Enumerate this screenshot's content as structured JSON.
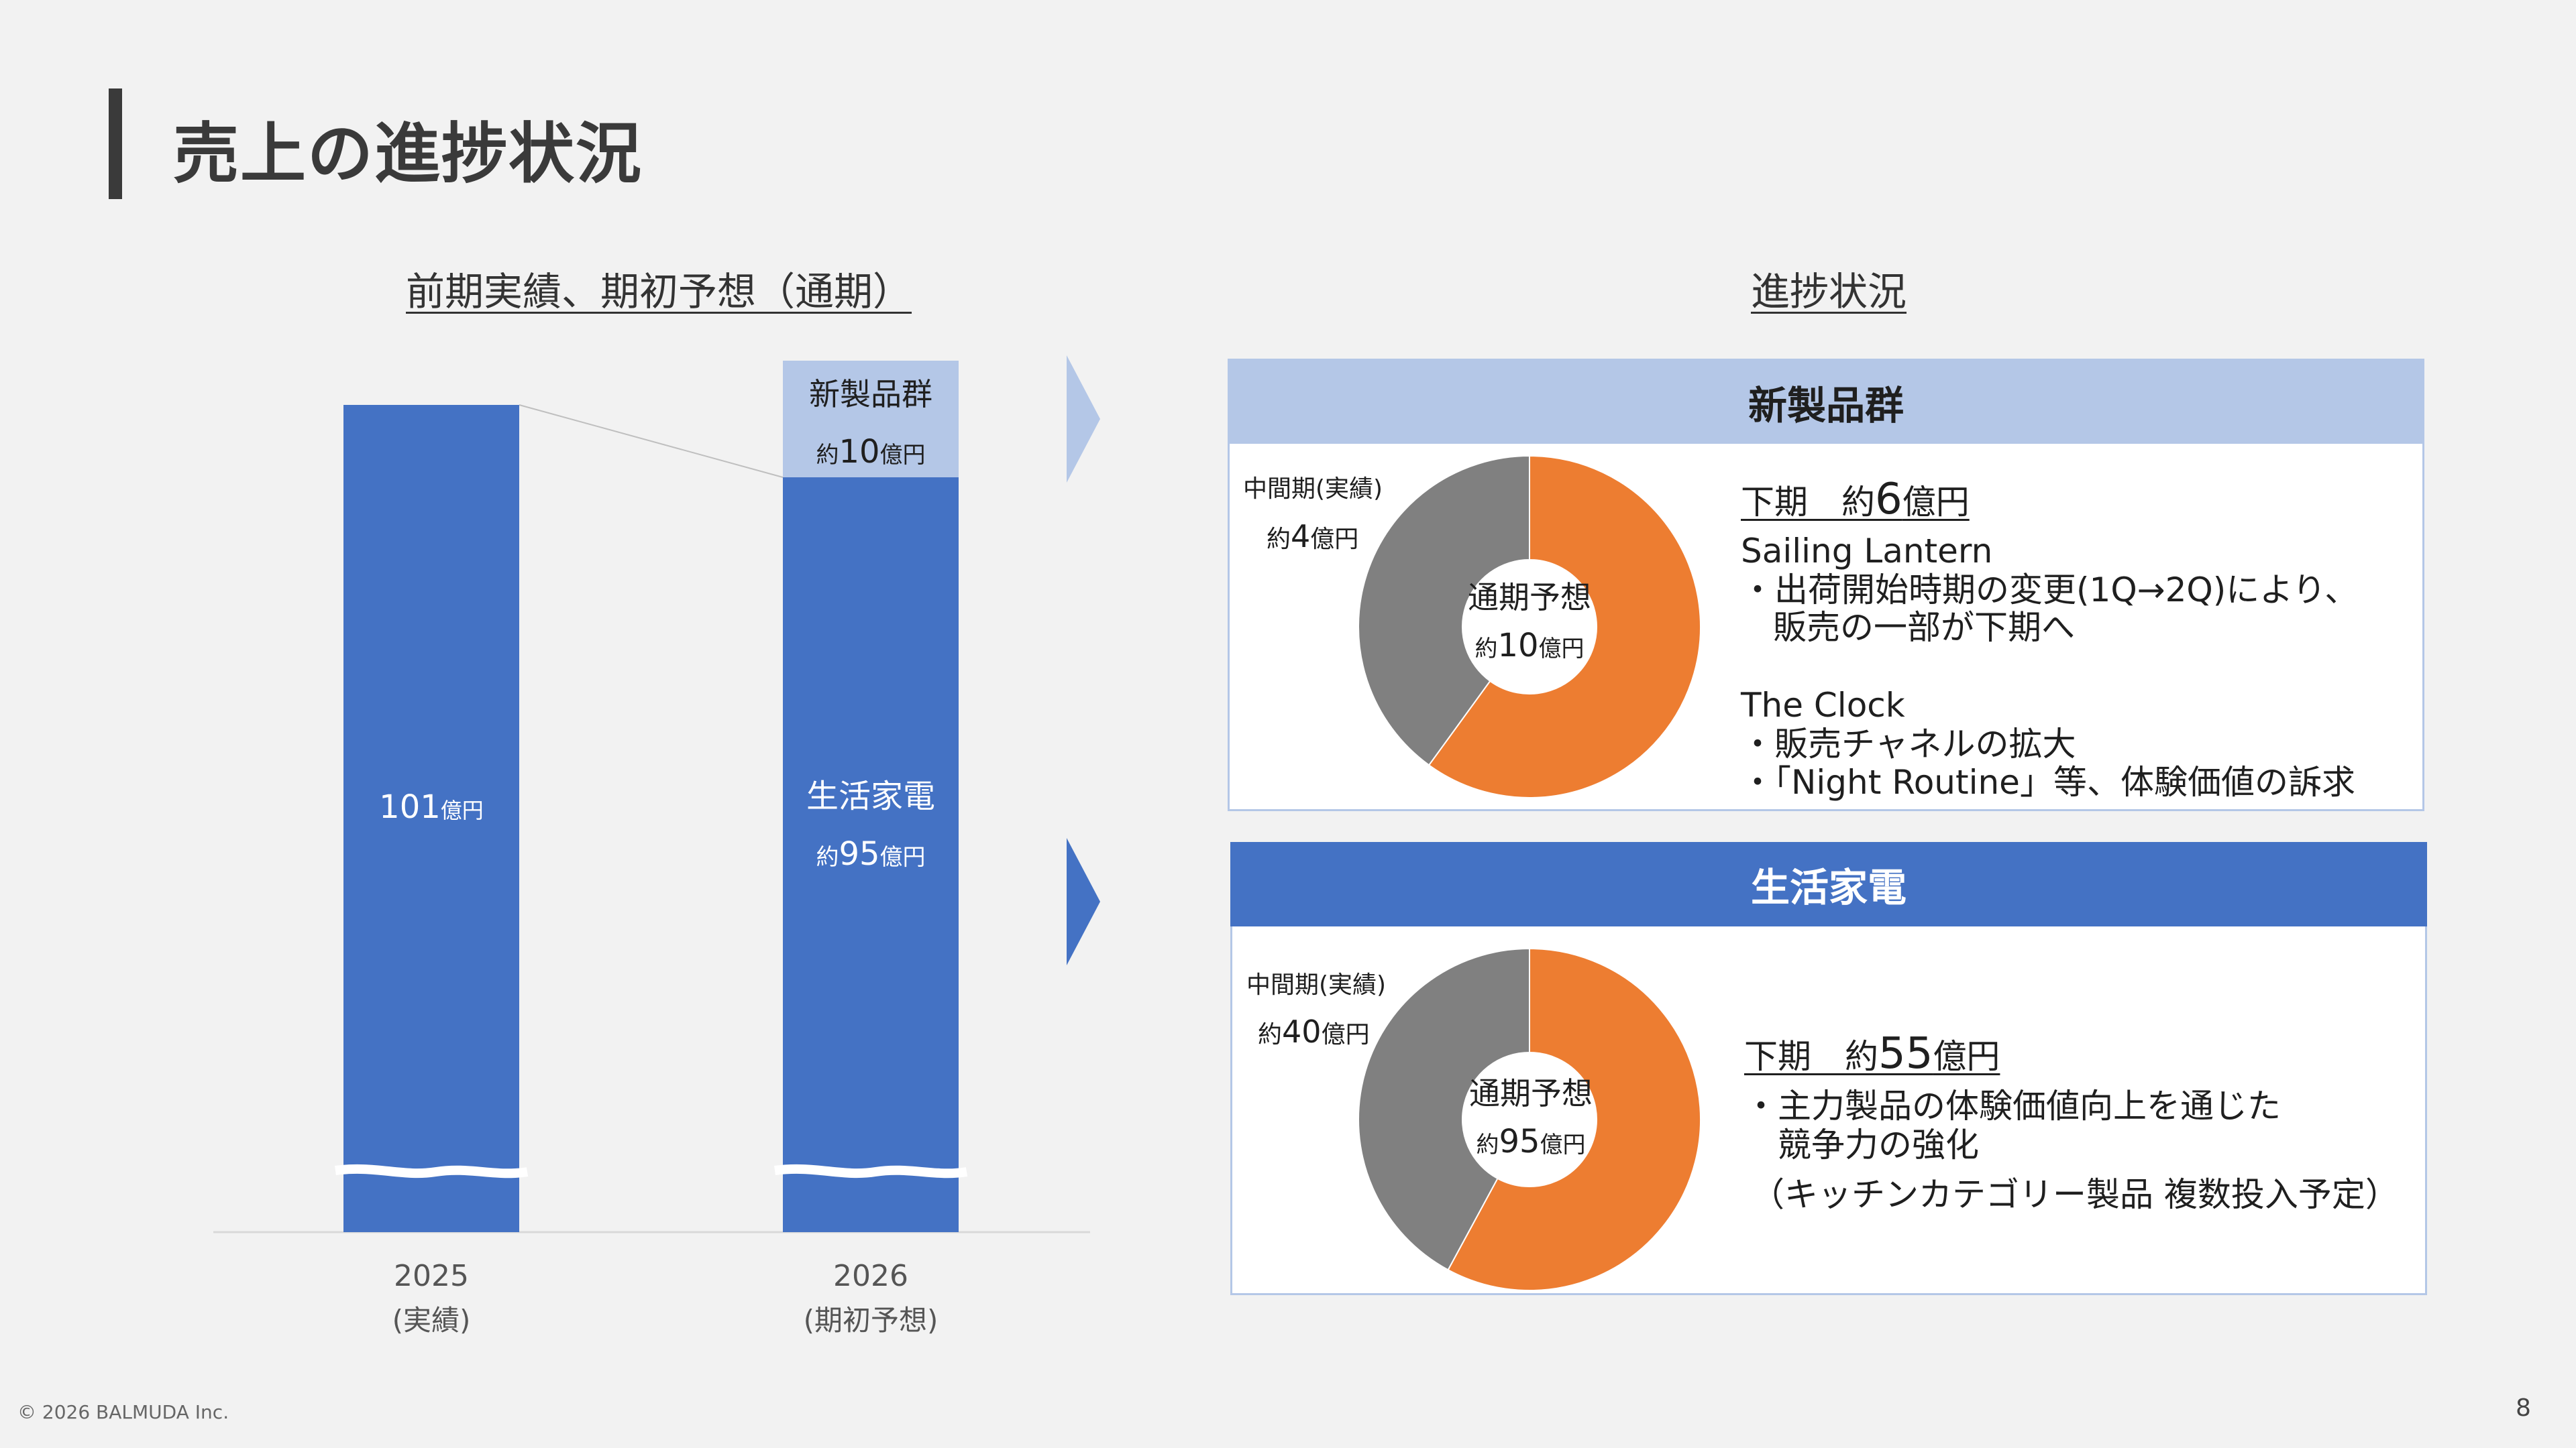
{
  "page": {
    "title": "売上の進捗状況",
    "footer": "© 2026 BALMUDA Inc.",
    "page_number": "8"
  },
  "left": {
    "heading": "前期実績、期初予想（通期）",
    "bar2025_label": "101億円",
    "bar2025_value": "101",
    "bar2025_unit": "億円",
    "top_segment_name": "新製品群",
    "top_segment_prefix": "約",
    "top_segment_value": "10",
    "top_segment_unit": "億円",
    "bottom_segment_name": "生活家電",
    "bottom_segment_prefix": "約",
    "bottom_segment_value": "95",
    "bottom_segment_unit": "億円"
  },
  "right": {
    "heading": "進捗状況",
    "panel1": {
      "header": "新製品群",
      "donut_gray_label1": "中間期(実績)",
      "donut_gray_prefix": "約",
      "donut_gray_value": "4",
      "donut_gray_unit": "億円",
      "center_title": "通期予想",
      "center_prefix": "約",
      "center_value": "10",
      "center_unit": "億円",
      "h2_text": "下期　約",
      "h2_num": "6",
      "h2_unit": "億円",
      "line1": "Sailing Lantern",
      "line2": "・出荷開始時期の変更(1Q→2Q)により、",
      "line3": "販売の一部が下期へ",
      "line4": "The Clock",
      "line5": "・販売チャネルの拡大",
      "line6": "・「Night Routine」等、体験価値の訴求"
    },
    "panel2": {
      "header": "生活家電",
      "donut_gray_label1": "中間期(実績)",
      "donut_gray_prefix": "約",
      "donut_gray_value": "40",
      "donut_gray_unit": "億円",
      "center_title": "通期予想",
      "center_prefix": "約",
      "center_value": "95",
      "center_unit": "億円",
      "h2_text": "下期　約",
      "h2_num": "55",
      "h2_unit": "億円",
      "line1": "・主力製品の体験価値向上を通じた",
      "line2": "競争力の強化",
      "line3": "（キッチンカテゴリー製品 複数投入予定）"
    }
  },
  "colors": {
    "bar_blue": "#4472c4",
    "bar_light": "#b4c7e7",
    "donut_orange": "#ed7d31",
    "donut_gray": "#808080"
  },
  "chart_data": [
    {
      "type": "bar",
      "categories": [
        "2025\n(実績)",
        "2026\n(期初予想)"
      ],
      "category_labels": [
        [
          "2025",
          "(実績)"
        ],
        [
          "2026",
          "(期初予想)"
        ]
      ],
      "series": [
        {
          "name": "生活家電",
          "values": [
            101,
            95
          ]
        },
        {
          "name": "新製品群",
          "values": [
            0,
            10
          ]
        }
      ],
      "axis_break": true
    },
    {
      "type": "pie",
      "donut": true,
      "slices": [
        {
          "name": "中間期(実績)",
          "value": 4,
          "color": "#808080"
        },
        {
          "name": "下期",
          "value": 6,
          "color": "#ed7d31"
        }
      ],
      "total": 10
    },
    {
      "type": "pie",
      "donut": true,
      "slices": [
        {
          "name": "中間期(実績)",
          "value": 40,
          "color": "#808080"
        },
        {
          "name": "下期",
          "value": 55,
          "color": "#ed7d31"
        }
      ],
      "total": 95
    }
  ]
}
